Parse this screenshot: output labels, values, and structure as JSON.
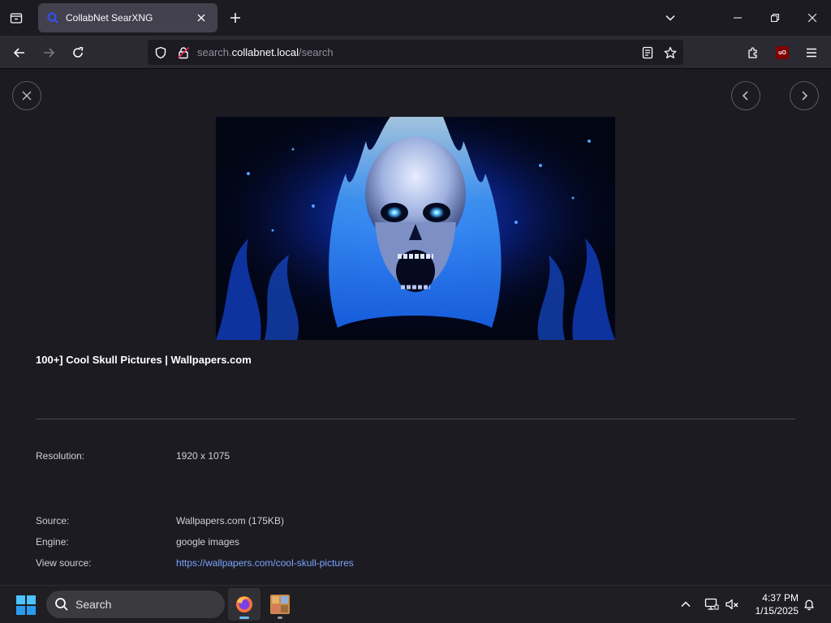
{
  "browser": {
    "tab": {
      "title": "CollabNet SearXNG"
    },
    "url": {
      "prefix": "search.",
      "host": "collabnet.local",
      "path": "/search"
    },
    "accent": "#7aa5ff"
  },
  "detail": {
    "title": "100+] Cool Skull Pictures | Wallpapers.com",
    "rows": [
      {
        "label": "Resolution:",
        "value": "1920 x 1075"
      },
      {
        "label": "Source:",
        "value": "Wallpapers.com (175KB)"
      },
      {
        "label": "Engine:",
        "value": "google images"
      },
      {
        "label": "View source:",
        "value": "https://wallpapers.com/cool-skull-pictures"
      }
    ]
  },
  "taskbar": {
    "search_placeholder": "Search",
    "time": "4:37 PM",
    "date": "1/15/2025"
  }
}
